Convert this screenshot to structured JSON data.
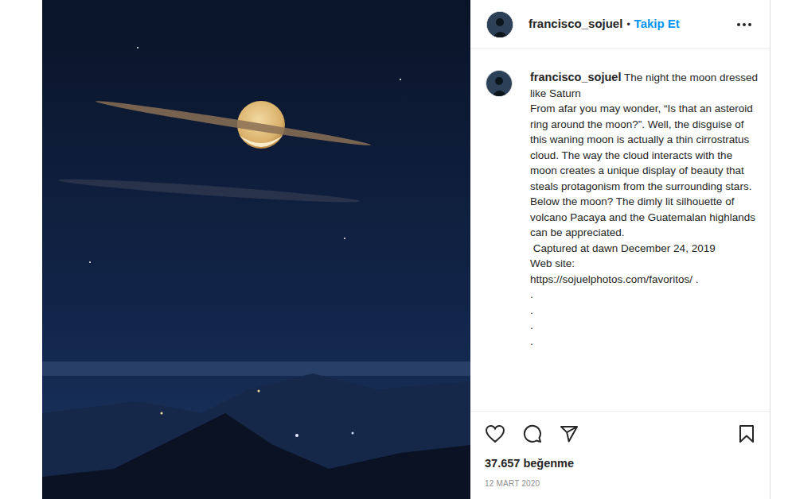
{
  "header": {
    "username": "francisco_sojuel",
    "separator": "•",
    "follow": "Takip Et"
  },
  "caption": {
    "username": "francisco_sojuel",
    "title": "The night the moon dressed like Saturn",
    "lines": [
      "From afar you may wonder, “Is that an asteroid ring around the moon?”. Well, the disguise of this waning moon is actually a thin cirrostratus cloud. The way the cloud interacts with the moon creates a unique display of beauty that steals protagonism from the surrounding stars. Below the moon? The dimly lit silhouette of volcano Pacaya and the Guatemalan highlands can be appreciated.",
      " Captured at dawn December 24, 2019",
      "Web site:",
      "https://sojuelphotos.com/favoritos/ .",
      ".",
      ".",
      ".",
      "."
    ]
  },
  "actions": {
    "liked": false,
    "saved": false
  },
  "likes": "37.657 beğenme",
  "date": "12 MART 2020"
}
